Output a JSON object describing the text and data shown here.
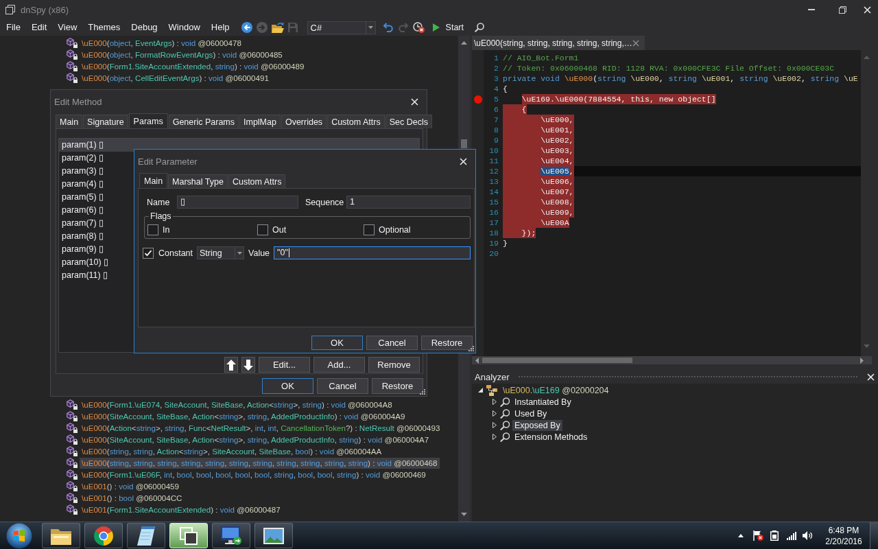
{
  "window": {
    "title": "dnSpy (x86)"
  },
  "menu": [
    "File",
    "Edit",
    "View",
    "Themes",
    "Debug",
    "Window",
    "Help"
  ],
  "toolbar": [
    {
      "kind": "back",
      "disabled": false
    },
    {
      "kind": "forward",
      "disabled": true
    },
    {
      "kind": "open",
      "disabled": false
    },
    {
      "kind": "save",
      "disabled": true
    },
    {
      "kind": "combo",
      "value": "C#",
      "disabled": false
    },
    {
      "kind": "undo",
      "disabled": false
    },
    {
      "kind": "redo",
      "disabled": true
    },
    {
      "kind": "history",
      "disabled": false
    },
    {
      "kind": "start",
      "label": "Start",
      "disabled": false
    },
    {
      "kind": "search",
      "disabled": false
    }
  ],
  "member_tree": {
    "upper_rows": [
      {
        "selected": false,
        "parts": [
          {
            "kind": "name",
            "text": "\\uE000"
          },
          {
            "kind": "punct",
            "text": "("
          },
          {
            "kind": "kw",
            "text": "object"
          },
          {
            "kind": "punct",
            "text": ", "
          },
          {
            "kind": "type",
            "text": "EventArgs"
          },
          {
            "kind": "punct",
            "text": ") : "
          },
          {
            "kind": "kw",
            "text": "void"
          },
          {
            "kind": "token",
            "text": " @06000478"
          }
        ]
      },
      {
        "selected": false,
        "parts": [
          {
            "kind": "name",
            "text": "\\uE000"
          },
          {
            "kind": "punct",
            "text": "("
          },
          {
            "kind": "kw",
            "text": "object"
          },
          {
            "kind": "punct",
            "text": ", "
          },
          {
            "kind": "type",
            "text": "FormatRowEventArgs"
          },
          {
            "kind": "punct",
            "text": ") : "
          },
          {
            "kind": "kw",
            "text": "void"
          },
          {
            "kind": "token",
            "text": " @06000485"
          }
        ]
      },
      {
        "selected": false,
        "parts": [
          {
            "kind": "name",
            "text": "\\uE000"
          },
          {
            "kind": "punct",
            "text": "("
          },
          {
            "kind": "type",
            "text": "Form1.SiteAccountExtended"
          },
          {
            "kind": "punct",
            "text": ", "
          },
          {
            "kind": "kw",
            "text": "string"
          },
          {
            "kind": "punct",
            "text": ") : "
          },
          {
            "kind": "kw",
            "text": "void"
          },
          {
            "kind": "token",
            "text": " @06000489"
          }
        ]
      },
      {
        "selected": false,
        "parts": [
          {
            "kind": "name",
            "text": "\\uE000"
          },
          {
            "kind": "punct",
            "text": "("
          },
          {
            "kind": "kw",
            "text": "object"
          },
          {
            "kind": "punct",
            "text": ", "
          },
          {
            "kind": "type",
            "text": "CellEditEventArgs"
          },
          {
            "kind": "punct",
            "text": ") : "
          },
          {
            "kind": "kw",
            "text": "void"
          },
          {
            "kind": "token",
            "text": " @06000491"
          }
        ]
      }
    ],
    "lower_rows": [
      {
        "selected": false,
        "parts": [
          {
            "kind": "name",
            "text": "\\uE000"
          },
          {
            "kind": "punct",
            "text": "("
          },
          {
            "kind": "type",
            "text": "Form1.\\uE074"
          },
          {
            "kind": "punct",
            "text": ", "
          },
          {
            "kind": "type",
            "text": "SiteAccount"
          },
          {
            "kind": "punct",
            "text": ", "
          },
          {
            "kind": "type",
            "text": "SiteBase"
          },
          {
            "kind": "punct",
            "text": ", "
          },
          {
            "kind": "type",
            "text": "Action"
          },
          {
            "kind": "punct",
            "text": "<"
          },
          {
            "kind": "kw",
            "text": "string"
          },
          {
            "kind": "punct",
            "text": ">, "
          },
          {
            "kind": "kw",
            "text": "string"
          },
          {
            "kind": "punct",
            "text": ") : "
          },
          {
            "kind": "kw",
            "text": "void"
          },
          {
            "kind": "token",
            "text": " @060004A8"
          }
        ]
      },
      {
        "selected": false,
        "parts": [
          {
            "kind": "name",
            "text": "\\uE000"
          },
          {
            "kind": "punct",
            "text": "("
          },
          {
            "kind": "type",
            "text": "SiteAccount"
          },
          {
            "kind": "punct",
            "text": ", "
          },
          {
            "kind": "type",
            "text": "SiteBase"
          },
          {
            "kind": "punct",
            "text": ", "
          },
          {
            "kind": "type",
            "text": "Action"
          },
          {
            "kind": "punct",
            "text": "<"
          },
          {
            "kind": "kw",
            "text": "string"
          },
          {
            "kind": "punct",
            "text": ">, "
          },
          {
            "kind": "kw",
            "text": "string"
          },
          {
            "kind": "punct",
            "text": ", "
          },
          {
            "kind": "type",
            "text": "AddedProductInfo"
          },
          {
            "kind": "punct",
            "text": ") : "
          },
          {
            "kind": "kw",
            "text": "void"
          },
          {
            "kind": "token",
            "text": " @060004A9"
          }
        ]
      },
      {
        "selected": false,
        "parts": [
          {
            "kind": "name",
            "text": "\\uE000"
          },
          {
            "kind": "punct",
            "text": "("
          },
          {
            "kind": "type",
            "text": "Action"
          },
          {
            "kind": "punct",
            "text": "<"
          },
          {
            "kind": "kw",
            "text": "string"
          },
          {
            "kind": "punct",
            "text": ">, "
          },
          {
            "kind": "kw",
            "text": "string"
          },
          {
            "kind": "punct",
            "text": ", "
          },
          {
            "kind": "type",
            "text": "Func"
          },
          {
            "kind": "punct",
            "text": "<"
          },
          {
            "kind": "type",
            "text": "NetResult"
          },
          {
            "kind": "punct",
            "text": ">, "
          },
          {
            "kind": "kw",
            "text": "int"
          },
          {
            "kind": "punct",
            "text": ", "
          },
          {
            "kind": "kw",
            "text": "int"
          },
          {
            "kind": "punct",
            "text": ", "
          },
          {
            "kind": "struct",
            "text": "CancellationToken"
          },
          {
            "kind": "punct",
            "text": "?) : "
          },
          {
            "kind": "type",
            "text": "NetResult"
          },
          {
            "kind": "token",
            "text": " @06000493"
          }
        ]
      },
      {
        "selected": false,
        "parts": [
          {
            "kind": "name",
            "text": "\\uE000"
          },
          {
            "kind": "punct",
            "text": "("
          },
          {
            "kind": "type",
            "text": "SiteAccount"
          },
          {
            "kind": "punct",
            "text": ", "
          },
          {
            "kind": "type",
            "text": "SiteBase"
          },
          {
            "kind": "punct",
            "text": ", "
          },
          {
            "kind": "type",
            "text": "Action"
          },
          {
            "kind": "punct",
            "text": "<"
          },
          {
            "kind": "kw",
            "text": "string"
          },
          {
            "kind": "punct",
            "text": ">, "
          },
          {
            "kind": "kw",
            "text": "string"
          },
          {
            "kind": "punct",
            "text": ", "
          },
          {
            "kind": "type",
            "text": "AddedProductInfo"
          },
          {
            "kind": "punct",
            "text": ", "
          },
          {
            "kind": "kw",
            "text": "string"
          },
          {
            "kind": "punct",
            "text": ") : "
          },
          {
            "kind": "kw",
            "text": "void"
          },
          {
            "kind": "token",
            "text": " @060004A7"
          }
        ]
      },
      {
        "selected": false,
        "parts": [
          {
            "kind": "name",
            "text": "\\uE000"
          },
          {
            "kind": "punct",
            "text": "("
          },
          {
            "kind": "kw",
            "text": "string"
          },
          {
            "kind": "punct",
            "text": ", "
          },
          {
            "kind": "kw",
            "text": "string"
          },
          {
            "kind": "punct",
            "text": ", "
          },
          {
            "kind": "type",
            "text": "Action"
          },
          {
            "kind": "punct",
            "text": "<"
          },
          {
            "kind": "kw",
            "text": "string"
          },
          {
            "kind": "punct",
            "text": ">, "
          },
          {
            "kind": "type",
            "text": "SiteAccount"
          },
          {
            "kind": "punct",
            "text": ", "
          },
          {
            "kind": "type",
            "text": "SiteBase"
          },
          {
            "kind": "punct",
            "text": ", "
          },
          {
            "kind": "kw",
            "text": "bool"
          },
          {
            "kind": "punct",
            "text": ") : "
          },
          {
            "kind": "kw",
            "text": "void"
          },
          {
            "kind": "token",
            "text": " @060004AA"
          }
        ]
      },
      {
        "selected": true,
        "parts": [
          {
            "kind": "name",
            "text": "\\uE000"
          },
          {
            "kind": "punct",
            "text": "("
          },
          {
            "kind": "kw",
            "text": "string"
          },
          {
            "kind": "punct",
            "text": ", "
          },
          {
            "kind": "kw",
            "text": "string"
          },
          {
            "kind": "punct",
            "text": ", "
          },
          {
            "kind": "kw",
            "text": "string"
          },
          {
            "kind": "punct",
            "text": ", "
          },
          {
            "kind": "kw",
            "text": "string"
          },
          {
            "kind": "punct",
            "text": ", "
          },
          {
            "kind": "kw",
            "text": "string"
          },
          {
            "kind": "punct",
            "text": ", "
          },
          {
            "kind": "kw",
            "text": "string"
          },
          {
            "kind": "punct",
            "text": ", "
          },
          {
            "kind": "kw",
            "text": "string"
          },
          {
            "kind": "punct",
            "text": ", "
          },
          {
            "kind": "kw",
            "text": "string"
          },
          {
            "kind": "punct",
            "text": ", "
          },
          {
            "kind": "kw",
            "text": "string"
          },
          {
            "kind": "punct",
            "text": ", "
          },
          {
            "kind": "kw",
            "text": "string"
          },
          {
            "kind": "punct",
            "text": ", "
          },
          {
            "kind": "kw",
            "text": "string"
          },
          {
            "kind": "punct",
            "text": ") : "
          },
          {
            "kind": "kw",
            "text": "void"
          },
          {
            "kind": "token",
            "text": " @06000468"
          }
        ]
      },
      {
        "selected": false,
        "parts": [
          {
            "kind": "name",
            "text": "\\uE000"
          },
          {
            "kind": "punct",
            "text": "("
          },
          {
            "kind": "type",
            "text": "Form1.\\uE06F"
          },
          {
            "kind": "punct",
            "text": ", "
          },
          {
            "kind": "kw",
            "text": "int"
          },
          {
            "kind": "punct",
            "text": ", "
          },
          {
            "kind": "kw",
            "text": "bool"
          },
          {
            "kind": "punct",
            "text": ", "
          },
          {
            "kind": "kw",
            "text": "bool"
          },
          {
            "kind": "punct",
            "text": ", "
          },
          {
            "kind": "kw",
            "text": "bool"
          },
          {
            "kind": "punct",
            "text": ", "
          },
          {
            "kind": "kw",
            "text": "bool"
          },
          {
            "kind": "punct",
            "text": ", "
          },
          {
            "kind": "kw",
            "text": "bool"
          },
          {
            "kind": "punct",
            "text": ", "
          },
          {
            "kind": "kw",
            "text": "string"
          },
          {
            "kind": "punct",
            "text": ", "
          },
          {
            "kind": "kw",
            "text": "bool"
          },
          {
            "kind": "punct",
            "text": ", "
          },
          {
            "kind": "kw",
            "text": "bool"
          },
          {
            "kind": "punct",
            "text": ", "
          },
          {
            "kind": "kw",
            "text": "string"
          },
          {
            "kind": "punct",
            "text": ") : "
          },
          {
            "kind": "kw",
            "text": "void"
          },
          {
            "kind": "token",
            "text": " @06000469"
          }
        ]
      },
      {
        "selected": false,
        "parts": [
          {
            "kind": "name",
            "text": "\\uE001"
          },
          {
            "kind": "punct",
            "text": "() : "
          },
          {
            "kind": "kw",
            "text": "void"
          },
          {
            "kind": "token",
            "text": " @06000459"
          }
        ]
      },
      {
        "selected": false,
        "parts": [
          {
            "kind": "name",
            "text": "\\uE001"
          },
          {
            "kind": "punct",
            "text": "() : "
          },
          {
            "kind": "kw",
            "text": "bool"
          },
          {
            "kind": "token",
            "text": " @060004CC"
          }
        ]
      },
      {
        "selected": false,
        "parts": [
          {
            "kind": "name",
            "text": "\\uE001"
          },
          {
            "kind": "punct",
            "text": "("
          },
          {
            "kind": "type",
            "text": "Form1.SiteAccountExtended"
          },
          {
            "kind": "punct",
            "text": ") : "
          },
          {
            "kind": "kw",
            "text": "void"
          },
          {
            "kind": "token",
            "text": " @06000487"
          }
        ]
      }
    ]
  },
  "edit_method_dialog": {
    "title": "Edit Method",
    "tabs": [
      {
        "label": "Main",
        "selected": false
      },
      {
        "label": "Signature",
        "selected": false
      },
      {
        "label": "Params",
        "selected": true
      },
      {
        "label": "Generic Params",
        "selected": false
      },
      {
        "label": "ImplMap",
        "selected": false
      },
      {
        "label": "Overrides",
        "selected": false
      },
      {
        "label": "Custom Attrs",
        "selected": false
      },
      {
        "label": "Sec Decls",
        "selected": false
      }
    ],
    "params": [
      {
        "label": "param(1) ▯",
        "selected": true
      },
      {
        "label": "param(2) ▯",
        "selected": false
      },
      {
        "label": "param(3) ▯",
        "selected": false
      },
      {
        "label": "param(4) ▯",
        "selected": false
      },
      {
        "label": "param(5) ▯",
        "selected": false
      },
      {
        "label": "param(6) ▯",
        "selected": false
      },
      {
        "label": "param(7) ▯",
        "selected": false
      },
      {
        "label": "param(8) ▯",
        "selected": false
      },
      {
        "label": "param(9) ▯",
        "selected": false
      },
      {
        "label": "param(10) ▯",
        "selected": false
      },
      {
        "label": "param(11) ▯",
        "selected": false
      }
    ],
    "list_buttons": [
      {
        "kind": "up"
      },
      {
        "kind": "down"
      },
      {
        "kind": "text",
        "label": "Edit..."
      },
      {
        "kind": "text",
        "label": "Add..."
      },
      {
        "kind": "text",
        "label": "Remove"
      }
    ],
    "buttons": [
      {
        "label": "OK",
        "default": true
      },
      {
        "label": "Cancel",
        "default": false
      },
      {
        "label": "Restore",
        "default": false
      }
    ]
  },
  "edit_parameter_dialog": {
    "title": "Edit Parameter",
    "tabs": [
      {
        "label": "Main",
        "selected": true
      },
      {
        "label": "Marshal Type",
        "selected": false
      },
      {
        "label": "Custom Attrs",
        "selected": false
      }
    ],
    "name": {
      "label": "Name",
      "value": "▯"
    },
    "sequence": {
      "label": "Sequence",
      "value": "1"
    },
    "flags": {
      "title": "Flags",
      "options": [
        {
          "label": "In",
          "checked": false
        },
        {
          "label": "Out",
          "checked": false
        },
        {
          "label": "Optional",
          "checked": false
        }
      ]
    },
    "constant": {
      "label": "Constant",
      "checked": true,
      "type": "String"
    },
    "value": {
      "label": "Value",
      "value": "\"0\"",
      "focused": true
    },
    "buttons": [
      {
        "label": "OK",
        "default": true
      },
      {
        "label": "Cancel",
        "default": false
      },
      {
        "label": "Restore",
        "default": false
      }
    ]
  },
  "editor": {
    "tab_title": "\\uE000(string, string, string, string, string,…",
    "lines": [
      {
        "number": "1",
        "current": false,
        "breakpoint": false,
        "highlighted": false,
        "tokens": [
          {
            "kind": "comment",
            "text": "// AIO_Bot.Form1"
          }
        ]
      },
      {
        "number": "2",
        "current": false,
        "breakpoint": false,
        "highlighted": false,
        "tokens": [
          {
            "kind": "comment",
            "text": "// Token: 0x06000468 RID: 1128 RVA: 0x000CFE3C File Offset: 0x000CE03C"
          }
        ]
      },
      {
        "number": "3",
        "current": false,
        "breakpoint": false,
        "highlighted": false,
        "tokens": [
          {
            "kind": "kw",
            "text": "private void "
          },
          {
            "kind": "name",
            "text": "\\uE000"
          },
          {
            "kind": "plain",
            "text": "("
          },
          {
            "kind": "kw",
            "text": "string "
          },
          {
            "kind": "param",
            "text": "\\uE000"
          },
          {
            "kind": "plain",
            "text": ", "
          },
          {
            "kind": "kw",
            "text": "string "
          },
          {
            "kind": "param",
            "text": "\\uE001"
          },
          {
            "kind": "plain",
            "text": ", "
          },
          {
            "kind": "kw",
            "text": "string "
          },
          {
            "kind": "param",
            "text": "\\uE002"
          },
          {
            "kind": "plain",
            "text": ", "
          },
          {
            "kind": "kw",
            "text": "string "
          },
          {
            "kind": "param",
            "text": "\\uE"
          }
        ]
      },
      {
        "number": "4",
        "current": false,
        "breakpoint": false,
        "highlighted": false,
        "tokens": [
          {
            "kind": "plain",
            "text": "{"
          }
        ],
        "children": [
          {
            "number": "5",
            "current": false,
            "breakpoint": true,
            "highlighted": true,
            "tokens": [
              {
                "kind": "plain",
                "text": "\\uE169.\\uE000(7884554, this, new object[]"
              }
            ]
          },
          {
            "number": "6",
            "current": false,
            "breakpoint": false,
            "highlighted": true,
            "tokens": [
              {
                "kind": "plain",
                "text": "{"
              }
            ],
            "children": [
              {
                "number": "7",
                "current": false,
                "breakpoint": false,
                "highlighted": true,
                "tokens": [
                  {
                    "kind": "plain",
                    "text": "\\uE000,"
                  }
                ]
              },
              {
                "number": "8",
                "current": false,
                "breakpoint": false,
                "highlighted": true,
                "tokens": [
                  {
                    "kind": "plain",
                    "text": "\\uE001,"
                  }
                ]
              },
              {
                "number": "9",
                "current": false,
                "breakpoint": false,
                "highlighted": true,
                "tokens": [
                  {
                    "kind": "plain",
                    "text": "\\uE002,"
                  }
                ]
              },
              {
                "number": "10",
                "current": false,
                "breakpoint": false,
                "highlighted": true,
                "tokens": [
                  {
                    "kind": "plain",
                    "text": "\\uE003,"
                  }
                ]
              },
              {
                "number": "11",
                "current": false,
                "breakpoint": false,
                "highlighted": true,
                "tokens": [
                  {
                    "kind": "plain",
                    "text": "\\uE004,"
                  }
                ]
              },
              {
                "number": "12",
                "current": true,
                "breakpoint": false,
                "highlighted": true,
                "tokens": [
                  {
                    "kind": "selection",
                    "text": "\\uE005"
                  },
                  {
                    "kind": "plain",
                    "text": ","
                  }
                ]
              },
              {
                "number": "13",
                "current": false,
                "breakpoint": false,
                "highlighted": true,
                "tokens": [
                  {
                    "kind": "plain",
                    "text": "\\uE006,"
                  }
                ]
              },
              {
                "number": "14",
                "current": false,
                "breakpoint": false,
                "highlighted": true,
                "tokens": [
                  {
                    "kind": "plain",
                    "text": "\\uE007,"
                  }
                ]
              },
              {
                "number": "15",
                "current": false,
                "breakpoint": false,
                "highlighted": true,
                "tokens": [
                  {
                    "kind": "plain",
                    "text": "\\uE008,"
                  }
                ]
              },
              {
                "number": "16",
                "current": false,
                "breakpoint": false,
                "highlighted": true,
                "tokens": [
                  {
                    "kind": "plain",
                    "text": "\\uE009,"
                  }
                ]
              },
              {
                "number": "17",
                "current": false,
                "breakpoint": false,
                "highlighted": true,
                "tokens": [
                  {
                    "kind": "plain",
                    "text": "\\uE00A"
                  }
                ]
              }
            ]
          },
          {
            "number": "18",
            "current": false,
            "breakpoint": false,
            "highlighted": true,
            "tokens": [
              {
                "kind": "plain",
                "text": "});"
              }
            ]
          }
        ]
      },
      {
        "number": "19",
        "current": false,
        "breakpoint": false,
        "highlighted": false,
        "tokens": [
          {
            "kind": "plain",
            "text": "}"
          }
        ]
      },
      {
        "number": "20"
      }
    ]
  },
  "analyzer": {
    "title": "Analyzer",
    "nodes": [
      {
        "parts": [
          {
            "kind": "ns",
            "text": "\\uE000"
          },
          {
            "kind": "punct",
            "text": "."
          },
          {
            "kind": "type",
            "text": "\\uE169"
          },
          {
            "kind": "token",
            "text": " @02000204"
          }
        ],
        "expanded": true,
        "selected": false,
        "children": [
          {
            "label": "Instantiated By",
            "expanded": false,
            "selected": false
          },
          {
            "label": "Used By",
            "expanded": false,
            "selected": false
          },
          {
            "label": "Exposed By",
            "expanded": false,
            "selected": true
          },
          {
            "label": "Extension Methods",
            "expanded": false,
            "selected": false
          }
        ]
      }
    ]
  },
  "taskbar": {
    "apps": [
      {
        "kind": "folder",
        "active": false
      },
      {
        "kind": "ring",
        "active": false
      },
      {
        "kind": "notepad",
        "active": false
      },
      {
        "kind": "windows",
        "active": true
      },
      {
        "kind": "monitor",
        "active": false
      },
      {
        "kind": "picture",
        "active": false
      }
    ],
    "time": "6:48 PM",
    "date": "2/20/2016"
  }
}
